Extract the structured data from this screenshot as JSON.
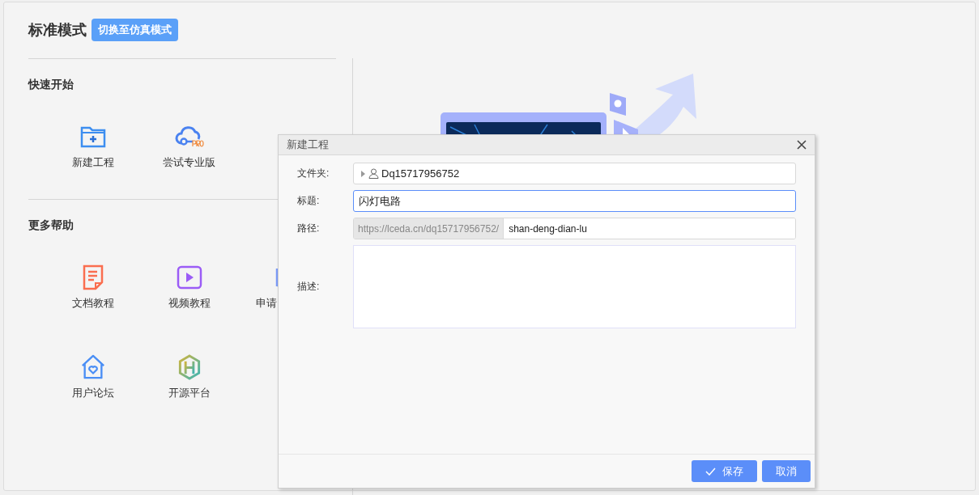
{
  "header": {
    "title": "标准模式",
    "switch_button": "切换至仿真模式"
  },
  "sections": [
    {
      "heading": "快速开始",
      "items": [
        {
          "kind": "folder",
          "label": "新建工程"
        },
        {
          "kind": "cloud",
          "label": "尝试专业版"
        }
      ]
    },
    {
      "heading": "更多帮助",
      "items": [
        {
          "kind": "doc",
          "label": "文档教程"
        },
        {
          "kind": "video",
          "label": "视频教程"
        },
        {
          "kind": "list",
          "label": "申请"
        },
        {
          "kind": "forum",
          "label": "用户论坛"
        },
        {
          "kind": "hex",
          "label": "开源平台"
        }
      ]
    }
  ],
  "dialog": {
    "title": "新建工程",
    "fields": [
      {
        "kind": "folder",
        "label": "文件夹:",
        "value": "Dq15717956752"
      },
      {
        "kind": "text",
        "label": "标题:",
        "value": "闪灯电路",
        "focused": true
      },
      {
        "kind": "path",
        "label": "路径:",
        "prefix": "https://lceda.cn/dq15717956752/",
        "value": "shan-deng-dian-lu",
        "focused": false
      },
      {
        "kind": "textarea",
        "label": "描述:",
        "focused": false
      }
    ],
    "buttons": [
      {
        "kind": "save",
        "label": "保存"
      },
      {
        "kind": "cancel",
        "label": "取消"
      }
    ]
  }
}
